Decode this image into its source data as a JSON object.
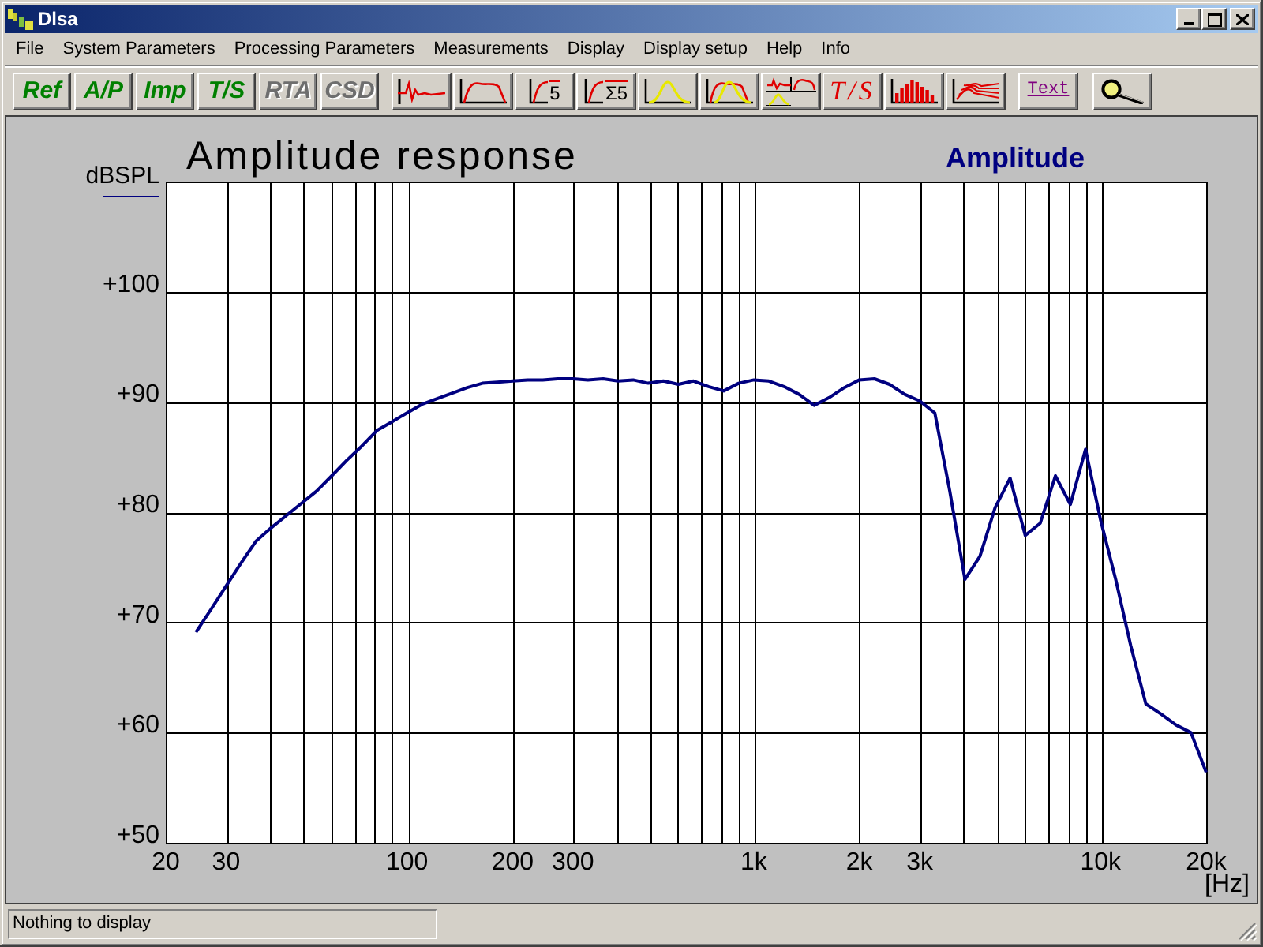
{
  "window": {
    "title": "Dlsa"
  },
  "menu": [
    "File",
    "System Parameters",
    "Processing Parameters",
    "Measurements",
    "Display",
    "Display setup",
    "Help",
    "Info"
  ],
  "toolbar": {
    "mode_buttons": [
      {
        "label": "Ref",
        "disabled": false
      },
      {
        "label": "A/P",
        "disabled": false
      },
      {
        "label": "Imp",
        "disabled": false
      },
      {
        "label": "T/S",
        "disabled": false
      },
      {
        "label": "RTA",
        "disabled": true
      },
      {
        "label": "CSD",
        "disabled": true
      }
    ],
    "view_buttons": [
      {
        "kind": "impulse"
      },
      {
        "kind": "curve"
      },
      {
        "kind": "curve",
        "label": "5"
      },
      {
        "kind": "curve",
        "label": "Σ5"
      },
      {
        "kind": "bell"
      },
      {
        "kind": "bells"
      },
      {
        "kind": "split"
      },
      {
        "kind": "script",
        "label": "T/S"
      },
      {
        "kind": "bars"
      },
      {
        "kind": "waterfall"
      }
    ],
    "extra_buttons": [
      {
        "kind": "underlined",
        "label": "Text"
      },
      {
        "kind": "zoom"
      }
    ]
  },
  "plot": {
    "chart_data": {
      "type": "line",
      "title": "Amplitude response",
      "xlabel": "[Hz]",
      "ylabel": "dBSPL",
      "grid": true,
      "categories": [
        "20",
        null,
        null,
        null,
        "30",
        null,
        null,
        null,
        null,
        null,
        null,
        null,
        null,
        null,
        null,
        null,
        "100",
        null,
        null,
        null,
        null,
        null,
        null,
        "200",
        null,
        null,
        null,
        "300",
        null,
        null,
        null,
        null,
        null,
        null,
        null,
        null,
        null,
        null,
        null,
        "1k",
        null,
        null,
        null,
        null,
        null,
        null,
        "2k",
        null,
        null,
        null,
        "3k",
        null,
        null,
        null,
        null,
        null,
        null,
        null,
        null,
        null,
        null,
        null,
        "10k",
        null,
        null,
        null,
        null,
        null,
        null,
        "20k"
      ],
      "series": [
        {
          "name": "Amplitude",
          "color": "#000080",
          "values": [
            null,
            null,
            69.1,
            71.2,
            73.3,
            75.4,
            77.4,
            78.6,
            79.7,
            80.8,
            81.9,
            83.3,
            84.7,
            86.0,
            87.4,
            88.2,
            89.0,
            89.8,
            90.3,
            90.8,
            91.3,
            91.7,
            91.8,
            91.9,
            92.0,
            92.0,
            92.1,
            92.1,
            92.0,
            92.1,
            91.9,
            92.0,
            91.7,
            91.9,
            91.6,
            91.9,
            91.4,
            91.0,
            91.7,
            92.0,
            91.9,
            91.4,
            90.7,
            89.7,
            90.4,
            91.3,
            92.0,
            92.1,
            91.6,
            90.7,
            90.1,
            89.0,
            81.9,
            73.9,
            76.0,
            80.4,
            83.1,
            77.9,
            79.0,
            83.3,
            80.7,
            85.7,
            79.3,
            73.9,
            67.9,
            62.6,
            61.7,
            60.7,
            60.0,
            56.4
          ]
        }
      ],
      "ylim": [
        50,
        110
      ],
      "yticks": [
        {
          "value": 50,
          "label": "+50"
        },
        {
          "value": 60,
          "label": "+60"
        },
        {
          "value": 70,
          "label": "+70"
        },
        {
          "value": 80,
          "label": "+80"
        },
        {
          "value": 90,
          "label": "+90"
        },
        {
          "value": 100,
          "label": "+100"
        }
      ]
    }
  },
  "status_bar": {
    "text": "Nothing to display"
  }
}
